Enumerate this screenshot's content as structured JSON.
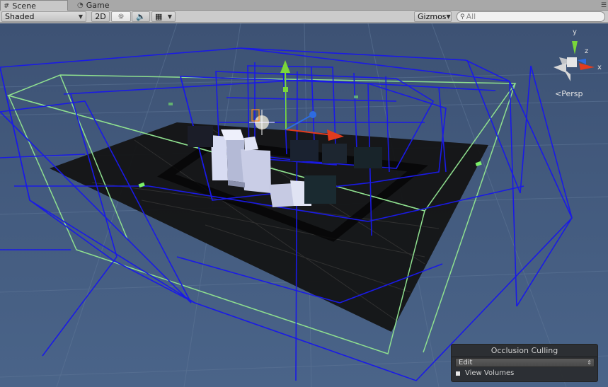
{
  "tabs": [
    {
      "label": "Scene",
      "icon": "grid-icon",
      "active": true
    },
    {
      "label": "Game",
      "icon": "pacman-icon",
      "active": false
    }
  ],
  "toolbar": {
    "render_mode": "Shaded",
    "mode_2d": "2D",
    "lighting_icon": "sun-icon",
    "audio_icon": "speaker-icon",
    "effects_icon": "image-icon",
    "gizmos_label": "Gizmos",
    "search_placeholder": "All"
  },
  "scene_gizmo": {
    "y_label": "y",
    "x_label": "x",
    "z_label": "z",
    "projection_label": "Persp"
  },
  "occlusion_panel": {
    "title": "Occlusion Culling",
    "mode_value": "Edit",
    "view_volumes_label": "View Volumes"
  },
  "colors": {
    "viewport_background": "#41577a",
    "volume_lines": "#1414e6",
    "bounds_lines": "#8fe08f",
    "ground": "#141414",
    "axis_x": "#e23c1e",
    "axis_y": "#7ad63a",
    "axis_z": "#2e6ce0"
  }
}
